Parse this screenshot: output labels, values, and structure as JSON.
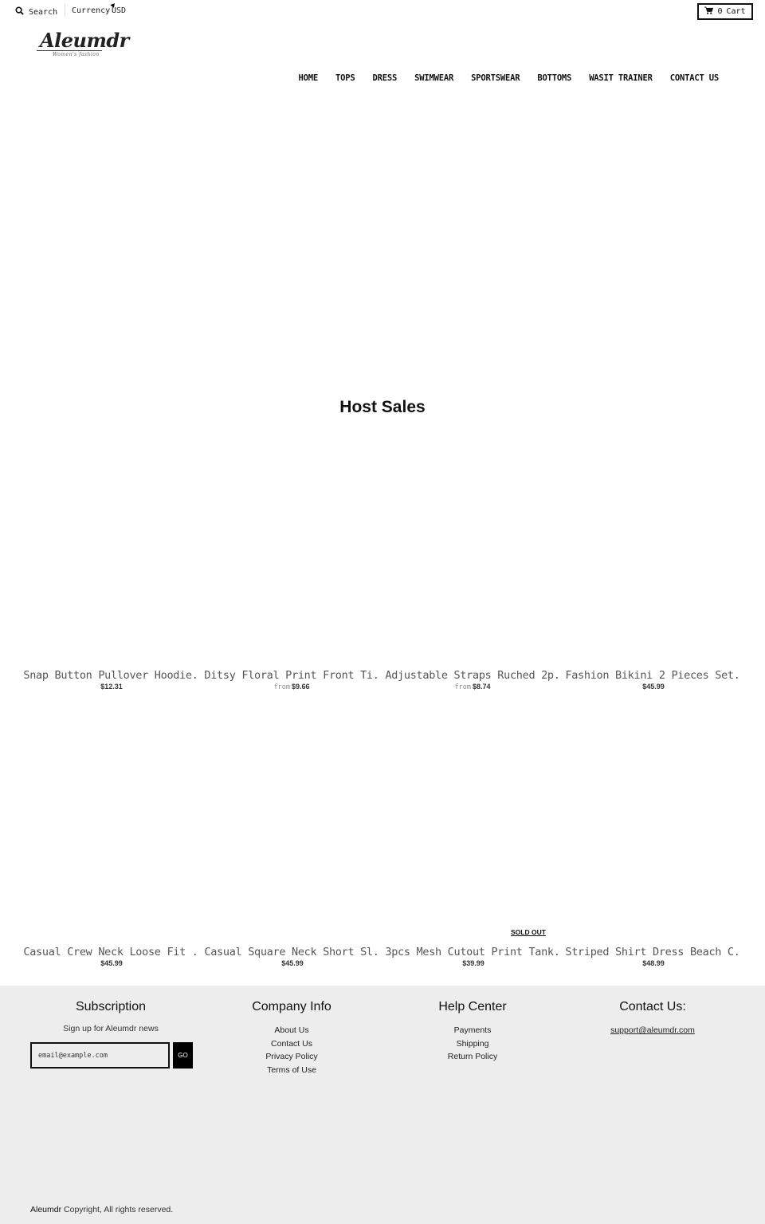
{
  "topbar": {
    "search_label": "Search",
    "currency_label": "Currency",
    "currency_value": "USD",
    "cart_count": "0",
    "cart_label": "Cart"
  },
  "logo": {
    "name": "Aleumdr",
    "tagline": "Women's fashion"
  },
  "nav": {
    "items": [
      "HOME",
      "TOPS",
      "DRESS",
      "SWIMWEAR",
      "SPORTSWEAR",
      "BOTTOMS",
      "WASIT TRAINER",
      "CONTACT US"
    ]
  },
  "section": {
    "title": "Host Sales"
  },
  "products": [
    {
      "title": "Snap Button Pullover Hoodie.",
      "price_prefix": "",
      "price": "$12.31",
      "sold_out": ""
    },
    {
      "title": "Ditsy Floral Print Front Ti.",
      "price_prefix": "from",
      "price": "$9.66",
      "sold_out": ""
    },
    {
      "title": "Adjustable Straps Ruched 2p.",
      "price_prefix": "from",
      "price": "$8.74",
      "sold_out": ""
    },
    {
      "title": "Fashion Bikini 2 Pieces Set.",
      "price_prefix": "",
      "price": "$45.99",
      "sold_out": ""
    },
    {
      "title": "Casual Crew Neck Loose Fit .",
      "price_prefix": "",
      "price": "$45.99",
      "sold_out": ""
    },
    {
      "title": "Casual Square Neck Short Sl.",
      "price_prefix": "",
      "price": "$45.99",
      "sold_out": ""
    },
    {
      "title": "3pcs Mesh Cutout Print Tank.",
      "price_prefix": "",
      "price": "$39.99",
      "sold_out": "SOLD OUT"
    },
    {
      "title": "Striped Shirt Dress Beach C.",
      "price_prefix": "",
      "price": "$48.99",
      "sold_out": ""
    }
  ],
  "footer": {
    "subscription": {
      "heading": "Subscription",
      "text": "Sign up for Aleumdr news",
      "email_placeholder": "email@example.com",
      "button": "GO"
    },
    "company": {
      "heading": "Company Info",
      "links": [
        "About Us",
        "Contact Us",
        "Privacy Policy",
        "Terms of Use"
      ]
    },
    "help": {
      "heading": "Help Center",
      "links": [
        "Payments",
        "Shipping",
        "Return Policy"
      ]
    },
    "contact": {
      "heading": "Contact Us:",
      "email": "support@aleumdr.com"
    },
    "copyright_brand": "Aleumdr",
    "copyright_text": " Copyright, All rights reserved."
  }
}
